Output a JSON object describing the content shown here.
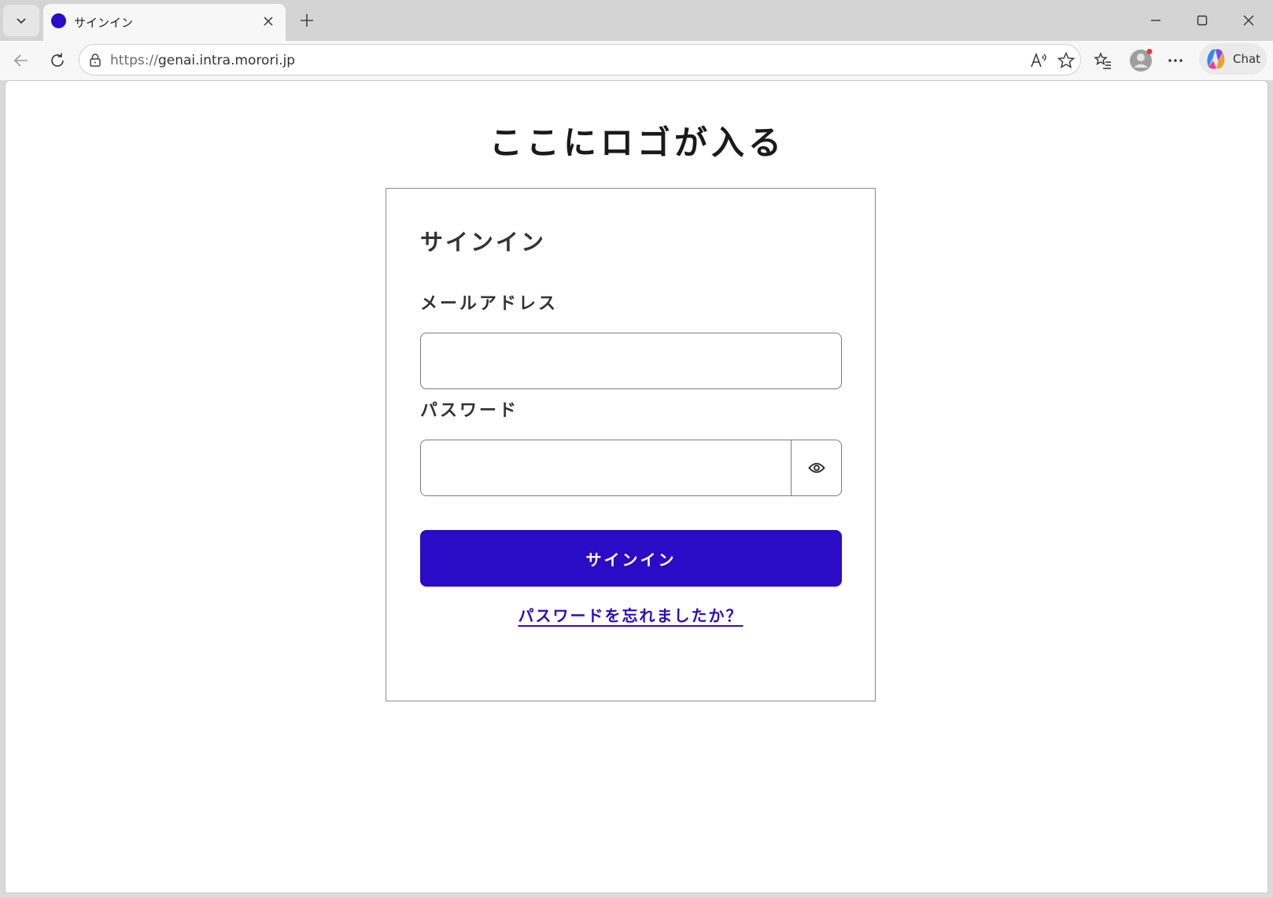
{
  "browser": {
    "tab": {
      "title": "サインイン",
      "favicon_color": "#2a0cc6"
    },
    "address_bar": {
      "scheme": "https://",
      "host": "genai.intra.morori.jp"
    },
    "chat_label": "Chat",
    "icons": {
      "tab_menu": "chevron-down-icon",
      "tab_close": "close-icon",
      "new_tab": "plus-icon",
      "minimize": "minimize-icon",
      "maximize": "maximize-icon",
      "close_window": "close-icon",
      "back": "arrow-left-icon",
      "reload": "reload-icon",
      "lock": "lock-icon",
      "read_aloud": "read-aloud-icon",
      "favorite": "star-icon",
      "favorites": "favorites-icon",
      "profile": "avatar-icon",
      "more": "more-icon",
      "copilot": "copilot-icon"
    }
  },
  "page": {
    "logo_text": "ここにロゴが入る",
    "card": {
      "title": "サインイン",
      "email_label": "メールアドレス",
      "email_value": "",
      "password_label": "パスワード",
      "password_value": "",
      "password_toggle_icon": "eye-icon",
      "signin_button": "サインイン",
      "forgot_link": "パスワードを忘れましたか？"
    },
    "accent_color": "#2a0cc6"
  }
}
